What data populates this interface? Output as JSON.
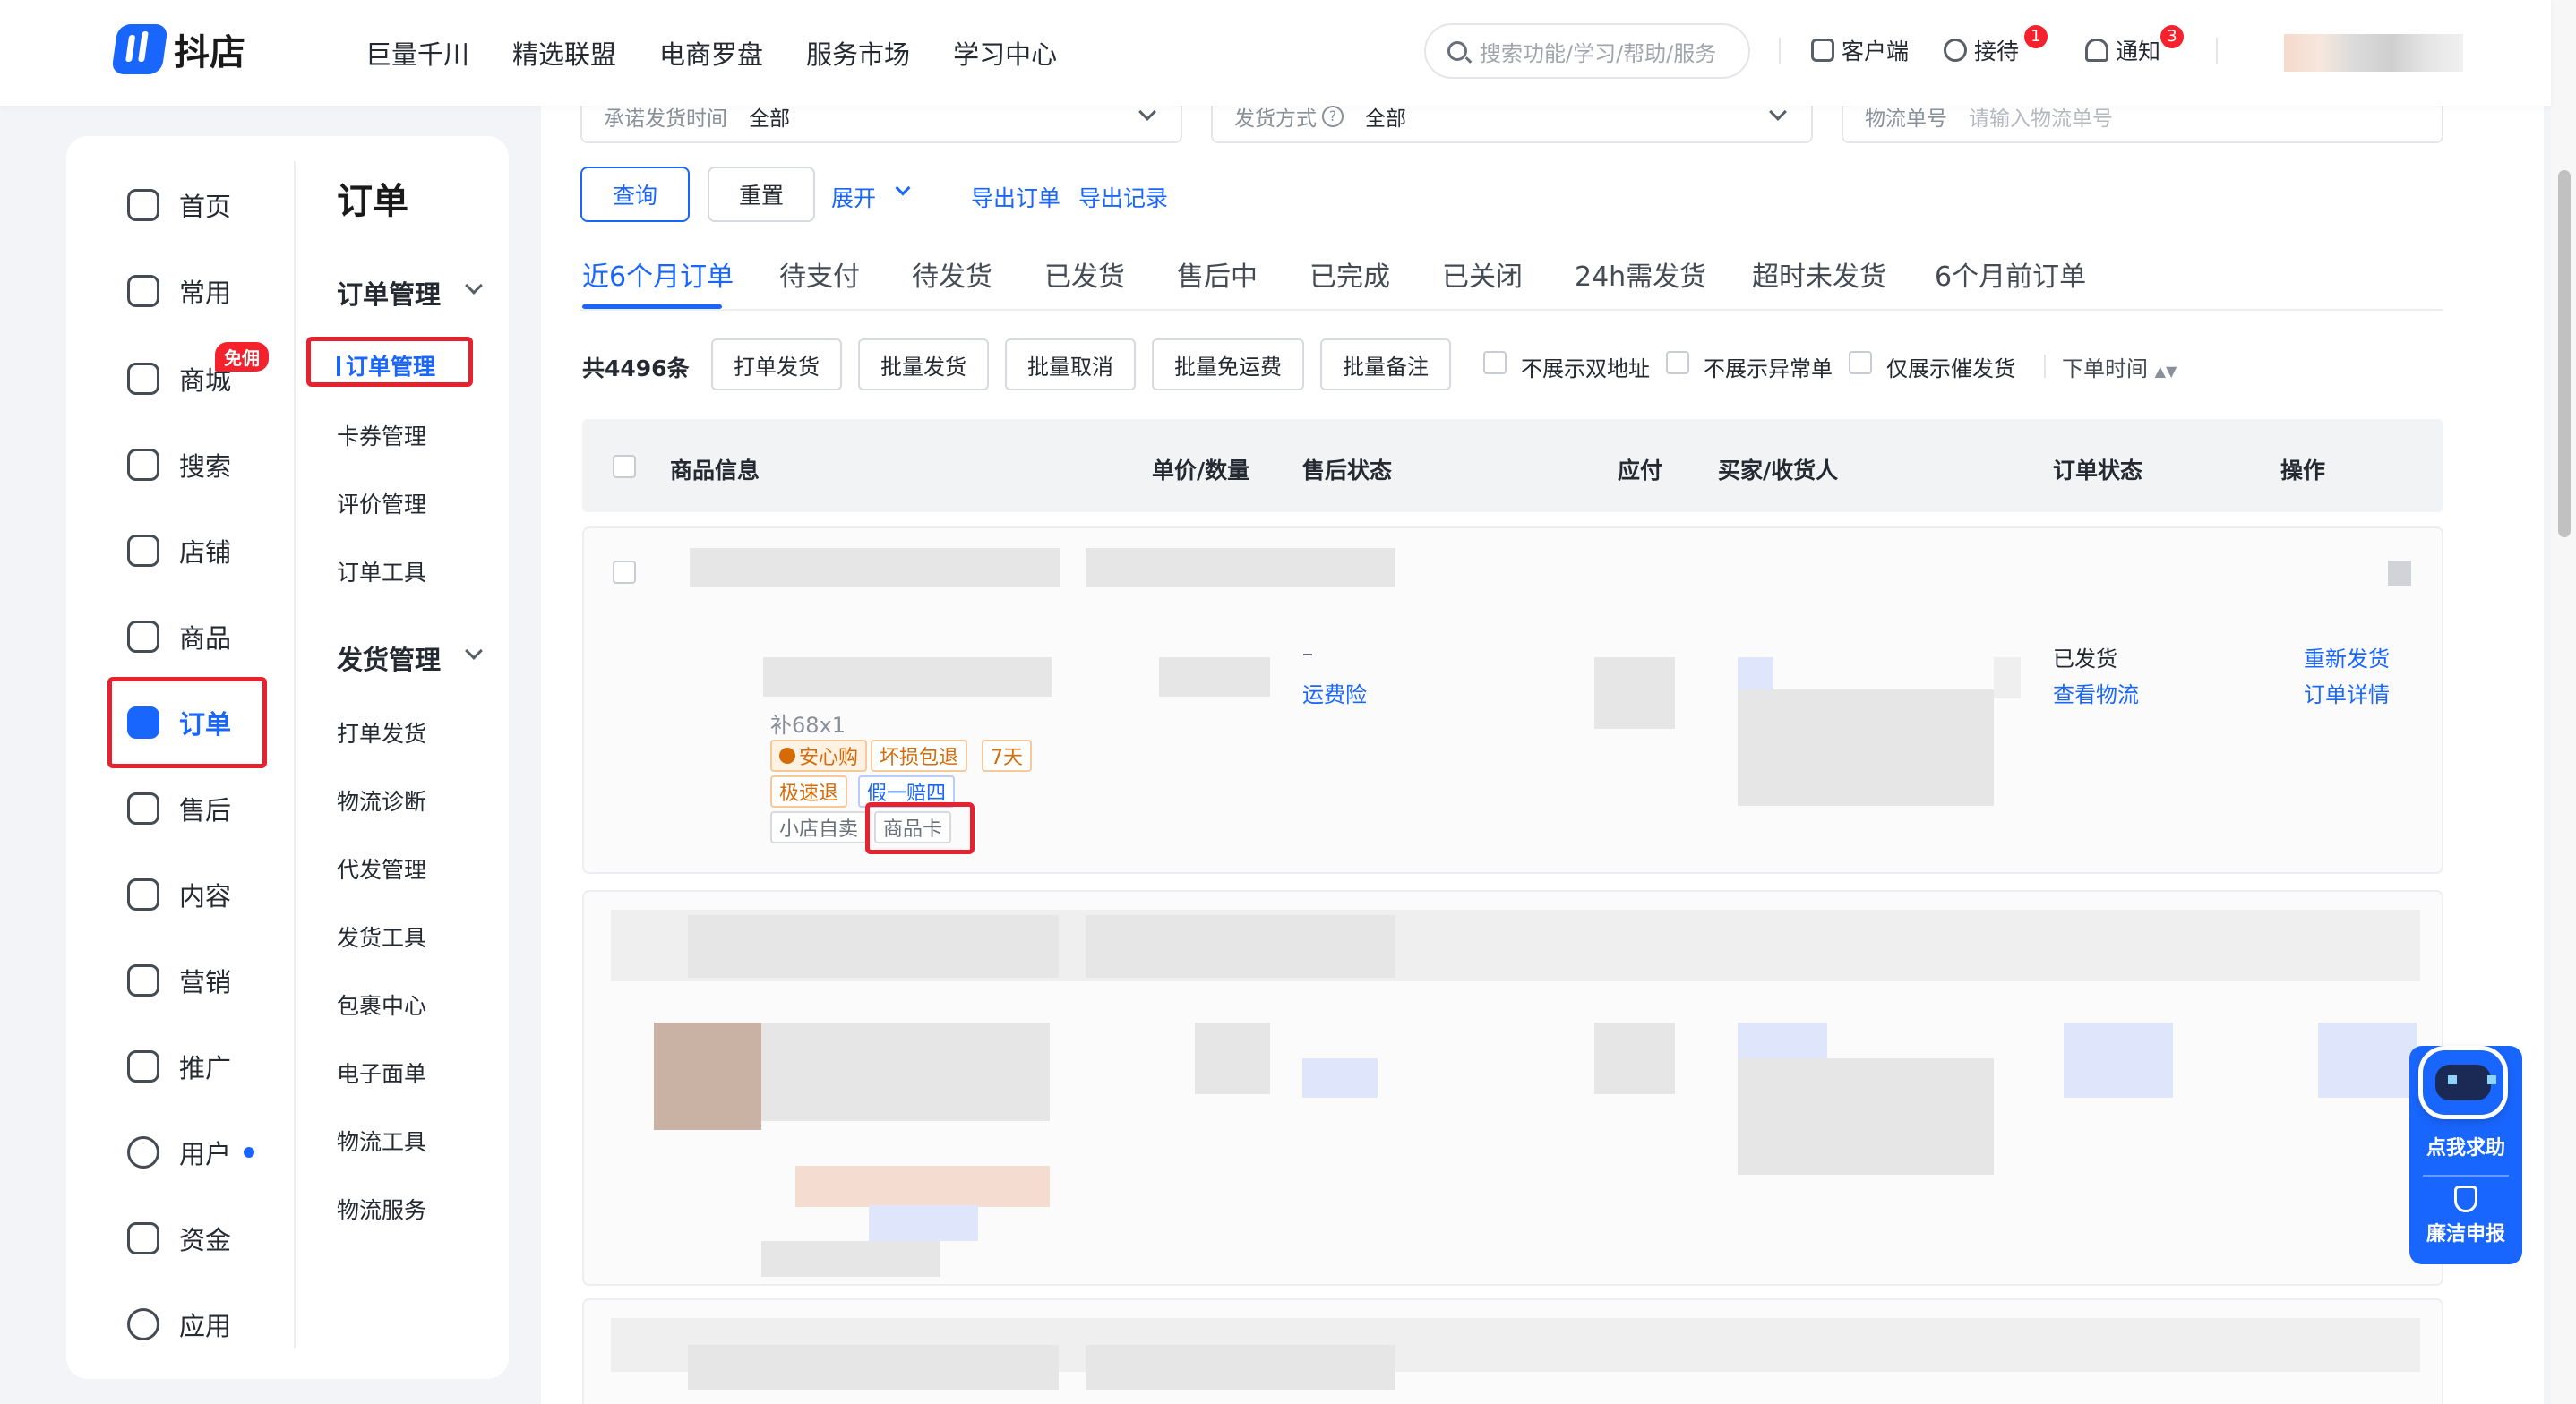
{
  "brand": {
    "name": "抖店"
  },
  "topnav": [
    "巨量千川",
    "精选联盟",
    "电商罗盘",
    "服务市场",
    "学习中心"
  ],
  "search": {
    "placeholder": "搜索功能/学习/帮助/服务"
  },
  "tools": {
    "client": "客户端",
    "reception": "接待",
    "reception_badge": "1",
    "notify": "通知",
    "notify_badge": "3"
  },
  "sidebar": {
    "items": [
      {
        "label": "首页",
        "icon": "home-icon"
      },
      {
        "label": "常用",
        "icon": "folder-icon"
      },
      {
        "label": "商城",
        "icon": "mall-icon",
        "badge": "免佣"
      },
      {
        "label": "搜索",
        "icon": "search-stats-icon"
      },
      {
        "label": "店铺",
        "icon": "store-icon"
      },
      {
        "label": "商品",
        "icon": "product-icon"
      },
      {
        "label": "订单",
        "icon": "order-icon",
        "active": true
      },
      {
        "label": "售后",
        "icon": "aftersale-icon"
      },
      {
        "label": "内容",
        "icon": "content-icon"
      },
      {
        "label": "营销",
        "icon": "marketing-icon"
      },
      {
        "label": "推广",
        "icon": "promotion-icon"
      },
      {
        "label": "用户",
        "icon": "user-icon",
        "dot": true
      },
      {
        "label": "资金",
        "icon": "wallet-icon"
      },
      {
        "label": "应用",
        "icon": "apps-icon"
      }
    ]
  },
  "subnav": {
    "title": "订单",
    "order_section": "订单管理",
    "order_items": [
      "订单管理",
      "卡券管理",
      "评价管理",
      "订单工具"
    ],
    "ship_section": "发货管理",
    "ship_items": [
      "打单发货",
      "物流诊断",
      "代发管理",
      "发货工具",
      "包裹中心",
      "电子面单",
      "物流工具",
      "物流服务"
    ]
  },
  "filters": {
    "ship_time_label": "承诺发货时间",
    "ship_time_value": "全部",
    "ship_method_label": "发货方式",
    "ship_method_value": "全部",
    "tracking_label": "物流单号",
    "tracking_placeholder": "请输入物流单号"
  },
  "actions": {
    "query": "查询",
    "reset": "重置",
    "expand": "展开",
    "export_orders": "导出订单",
    "export_records": "导出记录"
  },
  "tabs": [
    "近6个月订单",
    "待支付",
    "待发货",
    "已发货",
    "售后中",
    "已完成",
    "已关闭",
    "24h需发货",
    "超时未发货",
    "6个月前订单"
  ],
  "toolbar": {
    "count": "共4496条",
    "buttons": [
      "打单发货",
      "批量发货",
      "批量取消",
      "批量免运费",
      "批量备注"
    ],
    "options": [
      "不展示双地址",
      "不展示异常单",
      "仅展示催发货"
    ],
    "sort": "下单时间"
  },
  "table_headers": [
    "商品信息",
    "单价/数量",
    "售后状态",
    "应付",
    "买家/收货人",
    "订单状态",
    "操作"
  ],
  "order": {
    "qty": "补68x1",
    "tags": [
      "安心购",
      "坏损包退",
      "7天",
      "极速退",
      "假一赔四",
      "小店自卖",
      "商品卡"
    ],
    "aftersale": "–",
    "insurance": "运费险",
    "status": "已发货",
    "view_logistics": "查看物流",
    "reship": "重新发货",
    "detail": "订单详情"
  },
  "float_help": {
    "help": "点我求助",
    "report": "廉洁申报"
  }
}
